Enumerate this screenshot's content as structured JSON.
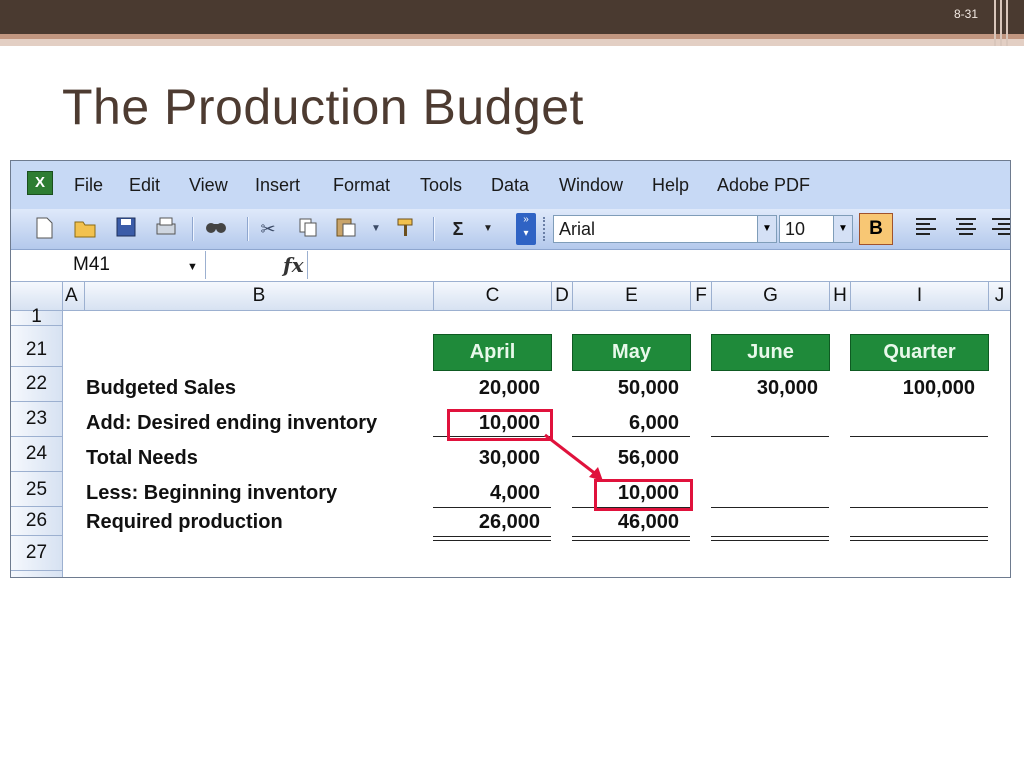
{
  "slide": {
    "number": "8-31",
    "title": "The Production Budget"
  },
  "excel": {
    "menu": [
      "File",
      "Edit",
      "View",
      "Insert",
      "Format",
      "Tools",
      "Data",
      "Window",
      "Help",
      "Adobe PDF"
    ],
    "toolbar": {
      "icons": [
        "new-icon",
        "open-icon",
        "save-icon",
        "print-icon",
        "research-icon",
        "cut-icon",
        "copy-icon",
        "paste-icon",
        "format-painter-icon",
        "autosum-icon"
      ],
      "autosum": "Σ",
      "font": "Arial",
      "font_size": "10",
      "bold": "B"
    },
    "name_box": "M41",
    "fx": "fx",
    "columns": [
      "A",
      "B",
      "C",
      "D",
      "E",
      "F",
      "G",
      "H",
      "I",
      "J"
    ],
    "rows": [
      "1",
      "21",
      "22",
      "23",
      "24",
      "25",
      "26",
      "27"
    ],
    "months": [
      "April",
      "May",
      "June",
      "Quarter"
    ],
    "table": {
      "budgeted_sales": {
        "label": "Budgeted Sales",
        "april": "20,000",
        "may": "50,000",
        "june": "30,000",
        "quarter": "100,000"
      },
      "desired_ending": {
        "label": "Add: Desired ending inventory",
        "april": "10,000",
        "may": "6,000"
      },
      "total_needs": {
        "label": "Total Needs",
        "april": "30,000",
        "may": "56,000"
      },
      "beginning_inventory": {
        "label": "Less: Beginning inventory",
        "april": "4,000",
        "may": "10,000"
      },
      "required_production": {
        "label": "Required production",
        "april": "26,000",
        "may": "46,000"
      }
    },
    "highlight_color": "#e0123c",
    "header_green": "#1f8a3a"
  }
}
